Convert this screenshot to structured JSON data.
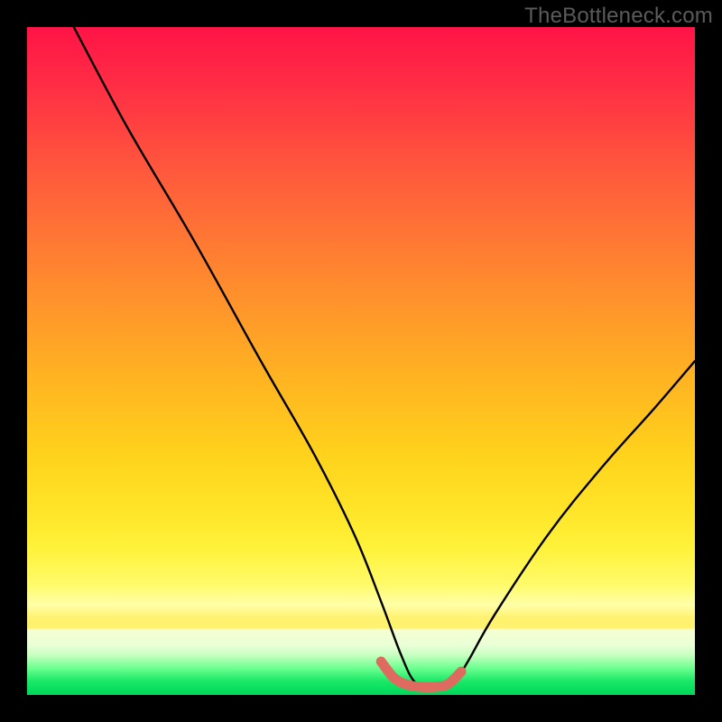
{
  "watermark": "TheBottleneck.com",
  "chart_data": {
    "type": "line",
    "title": "",
    "xlabel": "",
    "ylabel": "",
    "xlim": [
      0,
      100
    ],
    "ylim": [
      0,
      100
    ],
    "grid": false,
    "legend": "none",
    "notes": "Background is a vertical heat gradient from red (top = high bottleneck) to green (bottom = no bottleneck). A black V-shaped curve descends from top-left, reaches a flat minimum near x≈55–63 at the bottom, then rises toward the right edge about 40% up. A short salmon-colored thick segment highlights the flat minimum region.",
    "series": [
      {
        "name": "bottleneck-curve",
        "color": "#000000",
        "x": [
          7,
          15,
          25,
          35,
          43,
          49,
          53,
          56,
          58,
          60,
          62,
          64,
          66,
          70,
          78,
          86,
          94,
          100
        ],
        "values": [
          100,
          85,
          68,
          50,
          36,
          24,
          14,
          6,
          2,
          1.5,
          1.5,
          2,
          5,
          12,
          24,
          34,
          43,
          50
        ]
      },
      {
        "name": "optimal-zone-highlight",
        "color": "#e06a5f",
        "x": [
          53,
          55,
          57,
          59,
          61,
          63,
          65
        ],
        "values": [
          5,
          2.5,
          1.5,
          1.2,
          1.2,
          1.6,
          3.5
        ]
      }
    ]
  }
}
